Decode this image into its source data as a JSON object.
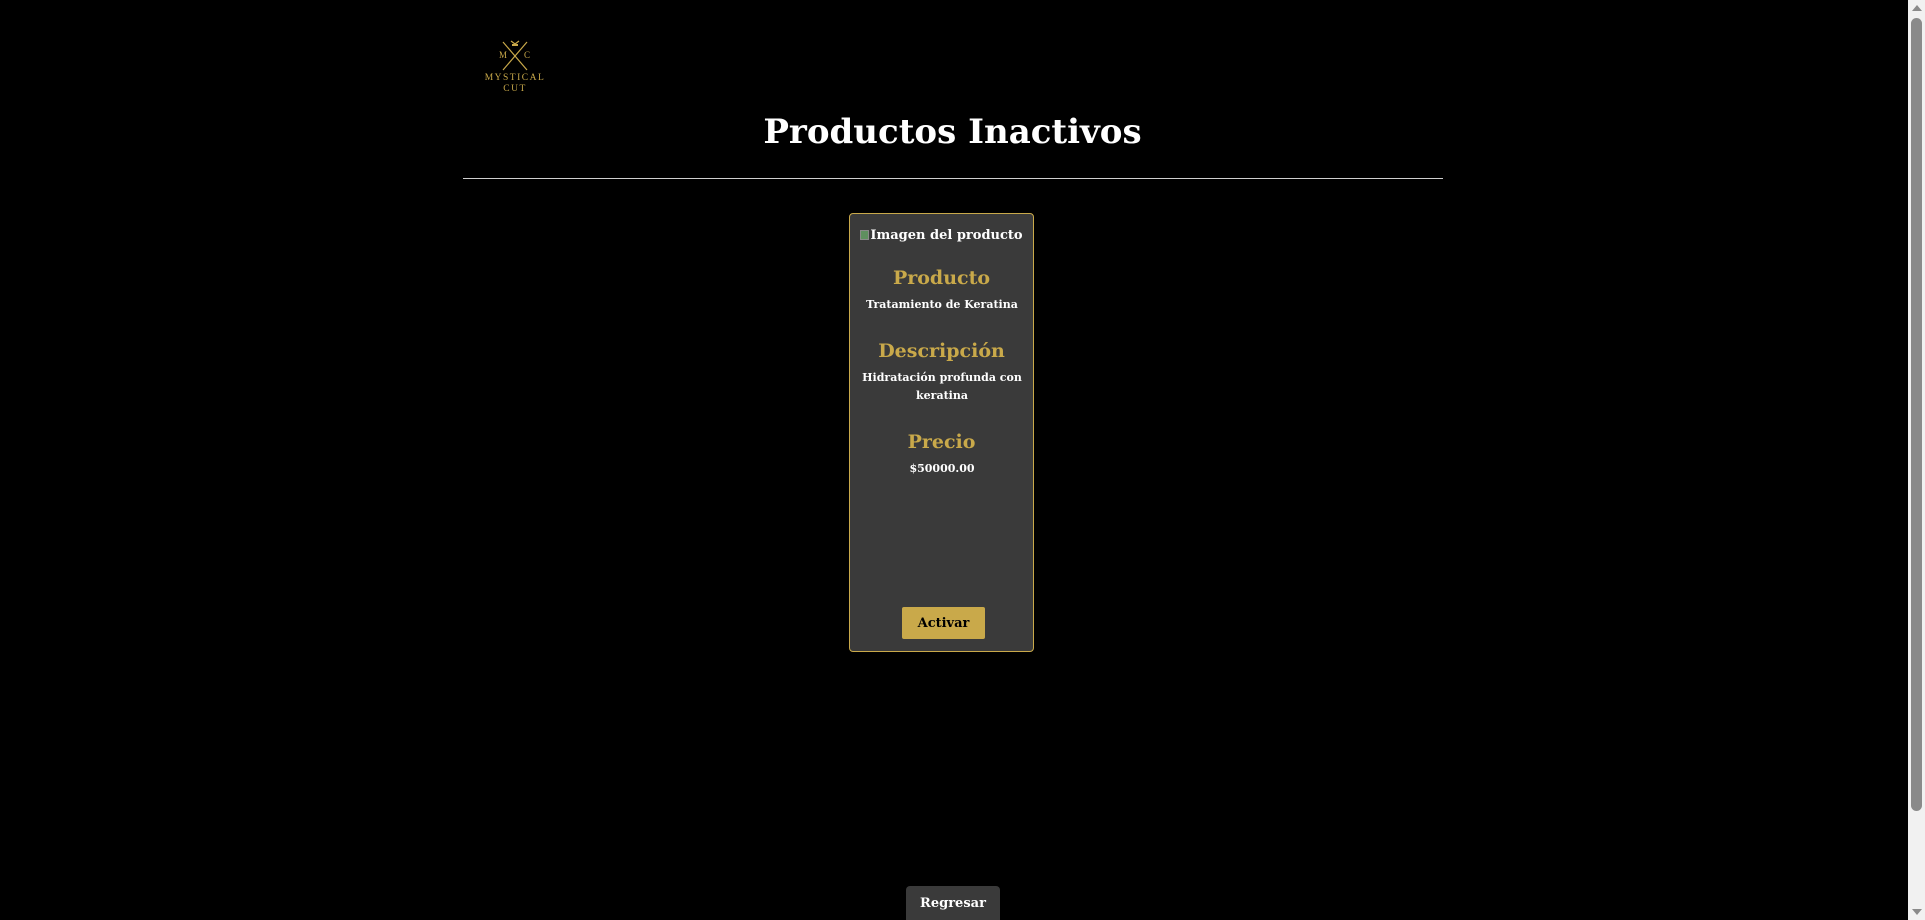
{
  "logo": {
    "initial_left": "M",
    "initial_right": "C",
    "line1": "MYSTICAL",
    "line2": "CUT",
    "icon": "crossed-razors-logo-icon"
  },
  "page_title": "Productos Inactivos",
  "product": {
    "image_alt": "Imagen del producto",
    "name_label": "Producto",
    "name": "Tratamiento de Keratina",
    "description_label": "Descripción",
    "description": "Hidratación profunda con keratina",
    "price_label": "Precio",
    "price": "$50000.00",
    "activate_label": "Activar"
  },
  "back_label": "Regresar",
  "colors": {
    "background": "#000000",
    "accent": "#c9a94a",
    "card": "#3a3a3a",
    "text": "#ffffff"
  }
}
